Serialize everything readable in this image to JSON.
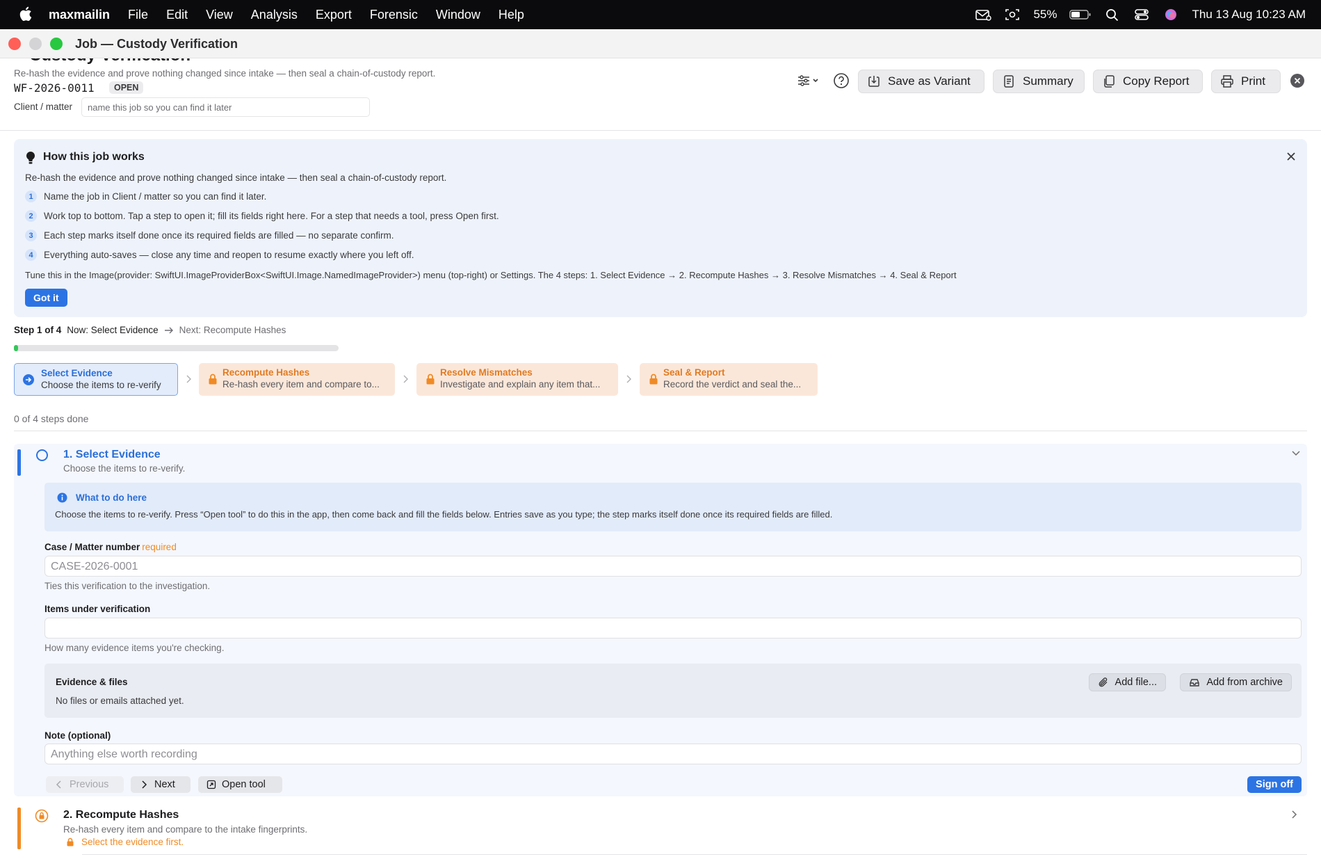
{
  "menubar": {
    "app": "maxmailin",
    "menus": [
      "File",
      "Edit",
      "View",
      "Analysis",
      "Export",
      "Forensic",
      "Window",
      "Help"
    ],
    "battery": "55%",
    "datetime": "Thu 13 Aug  10:23 AM"
  },
  "window": {
    "title": "Job — Custody Verification"
  },
  "header": {
    "title": "Custody Verification",
    "subtitle": "Re-hash the evidence and prove nothing changed since intake — then seal a chain-of-custody report.",
    "job_id": "WF-2026-0011",
    "status": "OPEN",
    "client_label": "Client / matter",
    "client_placeholder": "name this job so you can find it later"
  },
  "toolbar": {
    "save_variant": "Save as Variant",
    "summary": "Summary",
    "copy_report": "Copy Report",
    "print": "Print"
  },
  "info": {
    "heading": "How this job works",
    "intro": "Re-hash the evidence and prove nothing changed since intake — then seal a chain-of-custody report.",
    "steps": [
      {
        "n": "1",
        "text": "Name the job in Client / matter so you can find it later."
      },
      {
        "n": "2",
        "text": "Work top to bottom. Tap a step to open it; fill its fields right here. For a step that needs a tool, press Open first."
      },
      {
        "n": "3",
        "text": "Each step marks itself done once its required fields are filled — no separate confirm."
      },
      {
        "n": "4",
        "text": "Everything auto-saves — close any time and reopen to resume exactly where you left off."
      }
    ],
    "tune": "Tune this in the Image(provider: SwiftUI.ImageProviderBox<SwiftUI.Image.NamedImageProvider>) menu (top-right) or Settings. The 4 steps:  1. Select Evidence  →  2. Recompute Hashes  →  3. Resolve Mismatches  →  4. Seal & Report",
    "got_it": "Got it"
  },
  "progress": {
    "step_of": "Step 1 of 4",
    "now": "Now: Select Evidence",
    "next": "Next: Recompute Hashes",
    "fraction": 0.01,
    "done_text": "0 of 4 steps done"
  },
  "stepcards": [
    {
      "title": "Select Evidence",
      "desc": "Choose the items to re-verify",
      "state": "active"
    },
    {
      "title": "Recompute Hashes",
      "desc": "Re-hash every item and compare to...",
      "state": "locked"
    },
    {
      "title": "Resolve Mismatches",
      "desc": "Investigate and explain any item that...",
      "state": "locked"
    },
    {
      "title": "Seal & Report",
      "desc": "Record the verdict and seal the...",
      "state": "locked"
    }
  ],
  "step1": {
    "title": "1. Select Evidence",
    "desc": "Choose the items to re-verify.",
    "what_heading": "What to do here",
    "what_body": "Choose the items to re-verify. Press “Open tool” to do this in the app, then come back and fill the fields below. Entries save as you type; the step marks itself done once its required fields are filled.",
    "case_label": "Case / Matter number",
    "required": "required",
    "case_placeholder": "CASE-2026-0001",
    "case_help": "Ties this verification to the investigation.",
    "items_label": "Items under verification",
    "items_value": "",
    "items_help": "How many evidence items you're checking.",
    "evidence_heading": "Evidence & files",
    "evidence_empty": "No files or emails attached yet.",
    "add_file": "Add file...",
    "add_archive": "Add from archive",
    "note_label": "Note (optional)",
    "note_placeholder": "Anything else worth recording",
    "previous": "Previous",
    "next": "Next",
    "open_tool": "Open tool",
    "sign_off": "Sign off"
  },
  "step2": {
    "title": "2. Recompute Hashes",
    "desc": "Re-hash every item and compare to the intake fingerprints.",
    "warning": "Select the evidence first."
  }
}
